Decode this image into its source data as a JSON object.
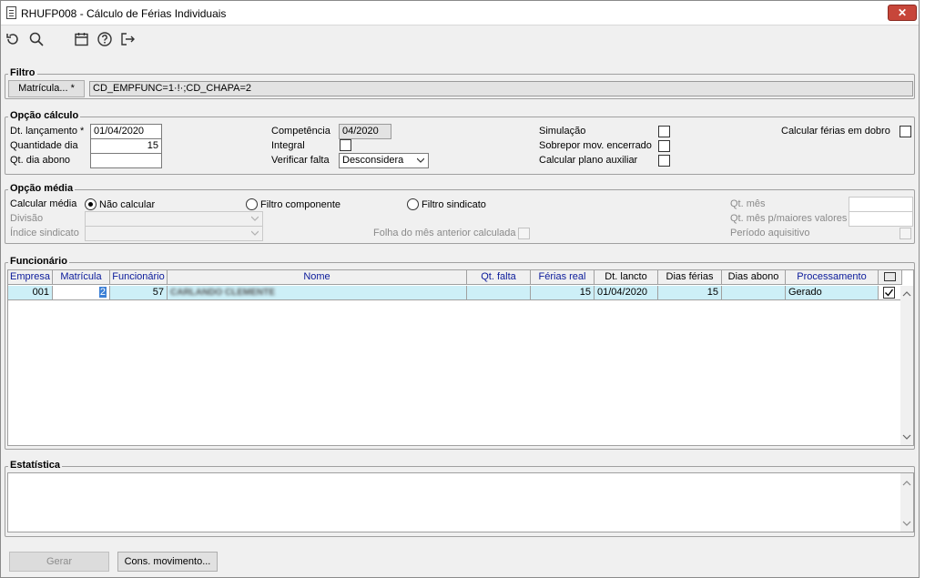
{
  "window": {
    "title": "RHUFP008 - Cálculo de Férias Individuais",
    "close_label": "✕"
  },
  "toolbar": {
    "icons": [
      "undo-icon",
      "search-icon",
      "calendar-icon",
      "help-icon",
      "exit-icon"
    ]
  },
  "filtro": {
    "label": "Filtro",
    "button_label": "Matrícula... *",
    "value": "CD_EMPFUNC=1·!·;CD_CHAPA=2"
  },
  "opcao_calculo": {
    "label": "Opção cálculo",
    "dt_lancamento_label": "Dt. lançamento *",
    "dt_lancamento_value": "01/04/2020",
    "quantidade_dia_label": "Quantidade dia",
    "quantidade_dia_value": "15",
    "qt_dia_abono_label": "Qt. dia abono",
    "qt_dia_abono_value": "",
    "competencia_label": "Competência",
    "competencia_value": "04/2020",
    "integral_label": "Integral",
    "verificar_falta_label": "Verificar falta",
    "verificar_falta_value": "Desconsidera",
    "simulacao_label": "Simulação",
    "sobrepor_label": "Sobrepor mov. encerrado",
    "calc_plano_label": "Calcular plano auxiliar",
    "calc_dobro_label": "Calcular férias em dobro"
  },
  "opcao_media": {
    "label": "Opção média",
    "calcular_media_label": "Calcular média",
    "radio_nao_calcular": "Não calcular",
    "radio_filtro_componente": "Filtro componente",
    "radio_filtro_sindicato": "Filtro sindicato",
    "divisao_label": "Divisão",
    "indice_sindicato_label": "Índice sindicato",
    "folha_mes_label": "Folha do mês anterior calculada",
    "qt_mes_label": "Qt. mês",
    "qt_mes_maiores_label": "Qt. mês p/maiores valores",
    "periodo_aquisitivo_label": "Período aquisitivo"
  },
  "funcionario": {
    "label": "Funcionário",
    "columns": [
      "Empresa",
      "Matrícula",
      "Funcionário",
      "Nome",
      "Qt. falta",
      "Férias real",
      "Dt. lancto",
      "Dias férias",
      "Dias abono",
      "Processamento"
    ],
    "rows": [
      {
        "empresa": "001",
        "matricula": "2",
        "funcionario": "57",
        "nome": "CARLANDO CLEMENTE",
        "qt_falta": "",
        "ferias_real": "15",
        "dt_lancto": "01/04/2020",
        "dias_ferias": "15",
        "dias_abono": "",
        "processamento": "Gerado"
      }
    ]
  },
  "estatistica": {
    "label": "Estatística"
  },
  "footer": {
    "gerar_label": "Gerar",
    "cons_movimento_label": "Cons. movimento..."
  }
}
